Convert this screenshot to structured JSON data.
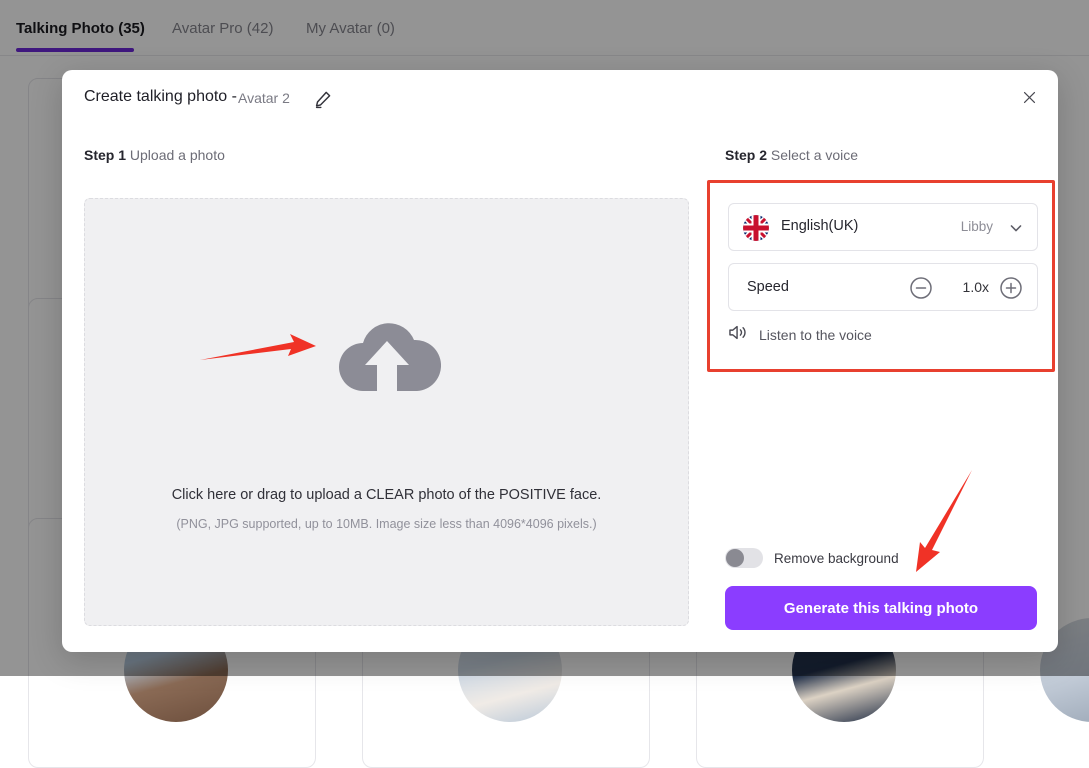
{
  "tabs": [
    {
      "label": "Talking Photo (35)",
      "active": true
    },
    {
      "label": "Avatar Pro (42)",
      "active": false
    },
    {
      "label": "My Avatar (0)",
      "active": false
    }
  ],
  "modal": {
    "title": "Create talking photo -",
    "avatar_name": "Avatar 2",
    "edit_icon": "pencil-icon",
    "close_icon": "close-icon",
    "step1": {
      "step": "Step 1",
      "text": " Upload a photo"
    },
    "step2": {
      "step": "Step 2",
      "text": " Select a voice"
    },
    "upload": {
      "icon": "cloud-upload-icon",
      "main_text": "Click here or drag to upload a CLEAR photo of the POSITIVE face.",
      "sub_text": "(PNG, JPG supported, up to 10MB. Image size less than 4096*4096 pixels.)"
    },
    "voice": {
      "flag_icon": "uk-flag-icon",
      "language": "English(UK)",
      "voice_name": "Libby",
      "chevron_icon": "chevron-down-icon",
      "speed_label": "Speed",
      "speed_value": "1.0x",
      "minus_icon": "minus-circle-icon",
      "plus_icon": "plus-circle-icon",
      "listen_icon": "speaker-icon",
      "listen_label": "Listen to the voice"
    },
    "remove_background": {
      "label": "Remove background",
      "enabled": false
    },
    "generate_label": "Generate this talking photo"
  },
  "colors": {
    "accent_purple": "#8b3dff",
    "tab_underline": "#6d28d9",
    "annotation_red": "#e8402f",
    "upload_bg": "#f0f0f2"
  }
}
